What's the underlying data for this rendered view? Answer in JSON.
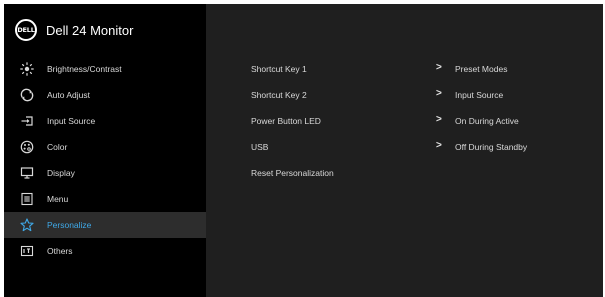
{
  "header": {
    "logo_text": "DELL",
    "title": "Dell 24 Monitor"
  },
  "sidebar": {
    "items": [
      {
        "label": "Brightness/Contrast",
        "icon": "brightness-icon"
      },
      {
        "label": "Auto Adjust",
        "icon": "auto-adjust-icon"
      },
      {
        "label": "Input Source",
        "icon": "input-source-icon"
      },
      {
        "label": "Color",
        "icon": "color-palette-icon"
      },
      {
        "label": "Display",
        "icon": "display-icon"
      },
      {
        "label": "Menu",
        "icon": "menu-icon"
      },
      {
        "label": "Personalize",
        "icon": "star-icon",
        "selected": true
      },
      {
        "label": "Others",
        "icon": "others-icon"
      }
    ],
    "selected_color": "#3fa9e8"
  },
  "content": {
    "rows": [
      {
        "label": "Shortcut Key 1",
        "arrow": ">",
        "value": "Preset Modes"
      },
      {
        "label": "Shortcut Key 2",
        "arrow": ">",
        "value": "Input Source"
      },
      {
        "label": "Power Button LED",
        "arrow": ">",
        "value": "On During Active"
      },
      {
        "label": "USB",
        "arrow": ">",
        "value": "Off During Standby"
      },
      {
        "label": "Reset Personalization",
        "arrow": "",
        "value": ""
      }
    ]
  }
}
